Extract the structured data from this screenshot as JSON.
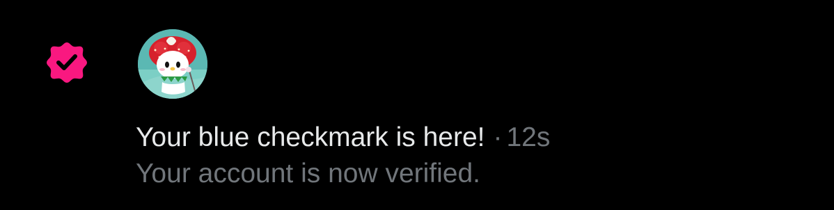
{
  "notification": {
    "badge_icon": "verified-check-icon",
    "badge_color": "#f91880",
    "avatar": "avatar-image",
    "title": "Your blue checkmark is here!",
    "separator": "·",
    "time": "12s",
    "body": "Your account is now verified."
  },
  "colors": {
    "background": "#000000",
    "primary_text": "#e7e9ea",
    "secondary_text": "#71767b"
  }
}
